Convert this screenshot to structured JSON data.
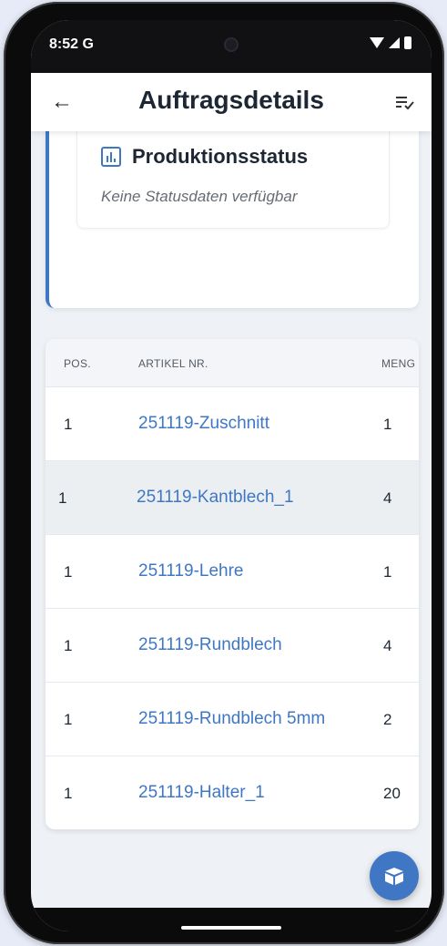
{
  "status_bar": {
    "time": "8:52",
    "carrier_icon": "G"
  },
  "app_bar": {
    "title": "Auftragsdetails",
    "back_icon": "arrow-left-icon",
    "menu_icon": "filter-list-icon"
  },
  "status_card": {
    "title": "Produktionsstatus",
    "subtitle": "Keine Statusdaten verfügbar",
    "accent": "#3f77c4"
  },
  "table": {
    "headers": {
      "pos": "POS.",
      "artikel": "ARTIKEL NR.",
      "menge": "MENG"
    },
    "rows": [
      {
        "pos": "1",
        "artikel": "251119-Zuschnitt",
        "menge": "1"
      },
      {
        "pos": "1",
        "artikel": "251119-Kantblech_1",
        "menge": "4"
      },
      {
        "pos": "1",
        "artikel": "251119-Lehre",
        "menge": "1"
      },
      {
        "pos": "1",
        "artikel": "251119-Rundblech",
        "menge": "4"
      },
      {
        "pos": "1",
        "artikel": "251119-Rundblech 5mm",
        "menge": "2"
      },
      {
        "pos": "1",
        "artikel": "251119-Halter_1",
        "menge": "20"
      }
    ]
  },
  "fab": {
    "icon": "package-box-icon",
    "color": "#3f77c4"
  },
  "colors": {
    "link": "#3f77c4",
    "background": "#eef1f5"
  }
}
